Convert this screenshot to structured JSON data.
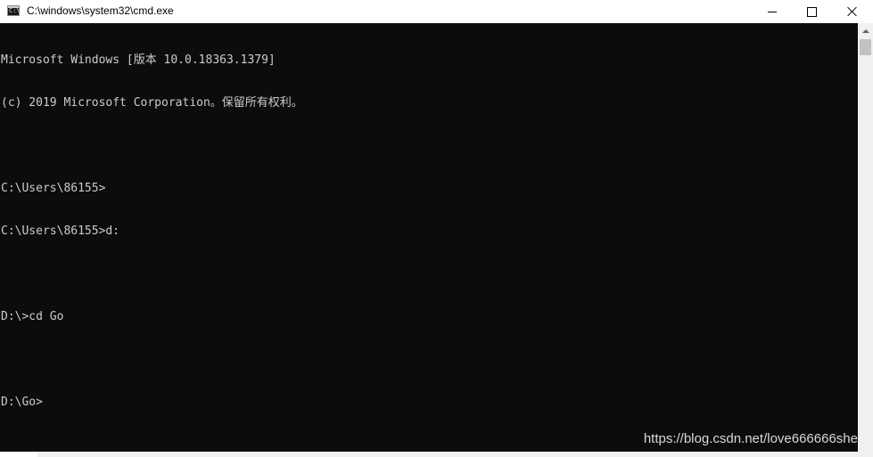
{
  "window": {
    "title": "C:\\windows\\system32\\cmd.exe",
    "icon": "cmd-icon",
    "icon_label": "C:\\"
  },
  "caption_buttons": {
    "minimize": "minimize-icon",
    "maximize": "maximize-icon",
    "close": "close-icon"
  },
  "console": {
    "background": "#0c0c0c",
    "foreground": "#cccccc",
    "lines": [
      "Microsoft Windows [版本 10.0.18363.1379]",
      "(c) 2019 Microsoft Corporation。保留所有权利。",
      "",
      "C:\\Users\\86155>",
      "C:\\Users\\86155>d:",
      "",
      "D:\\>cd Go",
      "",
      "D:\\Go>"
    ]
  },
  "watermark": "https://blog.csdn.net/love666666she"
}
